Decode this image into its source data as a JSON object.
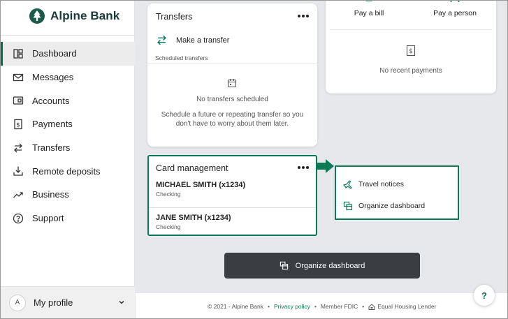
{
  "brand": {
    "name": "Alpine Bank",
    "accent": "#0a7a55"
  },
  "nav": {
    "items": [
      {
        "label": "Dashboard",
        "icon": "dashboard-icon",
        "active": true
      },
      {
        "label": "Messages",
        "icon": "envelope-icon"
      },
      {
        "label": "Accounts",
        "icon": "accounts-icon"
      },
      {
        "label": "Payments",
        "icon": "dollar-receipt-icon"
      },
      {
        "label": "Transfers",
        "icon": "transfer-arrows-icon"
      },
      {
        "label": "Remote deposits",
        "icon": "deposit-icon"
      },
      {
        "label": "Business",
        "icon": "trend-icon"
      },
      {
        "label": "Support",
        "icon": "question-circle-icon"
      }
    ]
  },
  "profile": {
    "initial": "A",
    "label": "My profile"
  },
  "transfers": {
    "title": "Transfers",
    "make_transfer": "Make a transfer",
    "scheduled_label": "Scheduled transfers",
    "empty_title": "No transfers scheduled",
    "empty_desc": "Schedule a future or repeating transfer so you don't have to worry about them later."
  },
  "payments": {
    "pay_bill": "Pay a bill",
    "pay_person": "Pay a person",
    "empty": "No recent payments"
  },
  "card_management": {
    "title": "Card management",
    "accounts": [
      {
        "name": "MICHAEL SMITH (x1234)",
        "type": "Checking"
      },
      {
        "name": "JANE SMITH (x1234)",
        "type": "Checking"
      }
    ]
  },
  "menu": {
    "items": [
      {
        "label": "Travel notices",
        "icon": "plane-icon"
      },
      {
        "label": "Organize dashboard",
        "icon": "organize-icon"
      }
    ]
  },
  "organize_button": "Organize dashboard",
  "footer": {
    "copyright": "© 2021 - Alpine Bank",
    "privacy": "Privacy policy",
    "fdic": "Member FDIC",
    "housing": "Equal Housing Lender",
    "separator": "•"
  },
  "help": "?"
}
